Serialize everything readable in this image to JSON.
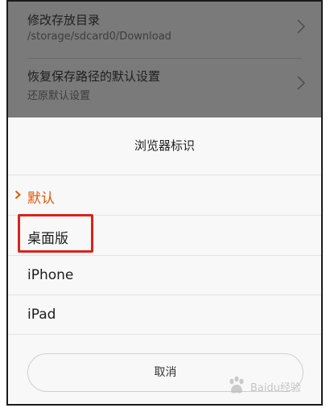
{
  "background": {
    "items": [
      {
        "title": "修改存放目录",
        "subtitle": "/storage/sdcard0/Download"
      },
      {
        "title": "恢复保存路径的默认设置",
        "subtitle": "还原默认设置"
      }
    ]
  },
  "dialog": {
    "title": "浏览器标识",
    "options": [
      {
        "label": "默认",
        "selected": true
      },
      {
        "label": "桌面版",
        "selected": false
      },
      {
        "label": "iPhone",
        "selected": false
      },
      {
        "label": "iPad",
        "selected": false
      }
    ],
    "cancel_label": "取消",
    "accent_color": "#e0580d"
  },
  "annotation": {
    "highlight_color": "#d9231c"
  },
  "watermark": {
    "text": "Baidu经验",
    "icon": "baidu-paw-icon"
  }
}
